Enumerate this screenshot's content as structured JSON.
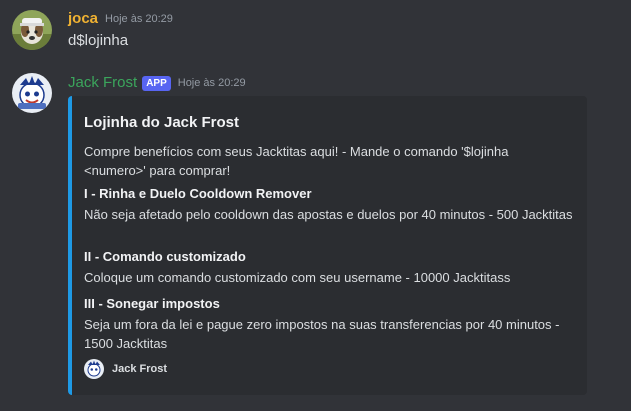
{
  "colors": {
    "background": "#313338",
    "joca_name": "#f0b232",
    "jack_name": "#3ba55c",
    "app_tag": "#5865f2",
    "embed_bar": "#1e9ae6",
    "embed_bg": "#2b2d31"
  },
  "messages": [
    {
      "author": "joca",
      "timestamp": "Hoje às 20:29",
      "content": "d$lojinha",
      "avatar_icon": "dog-avatar-icon"
    },
    {
      "author": "Jack Frost",
      "tag": "APP",
      "timestamp": "Hoje às 20:29",
      "avatar_icon": "jack-frost-avatar-icon",
      "embed": {
        "title": "Lojinha do Jack Frost",
        "description": "Compre benefícios com seus Jacktitas aqui! - Mande o comando '$lojinha <numero>' para comprar!",
        "fields": [
          {
            "name": "I - Rinha e Duelo Cooldown Remover",
            "value": "Não seja afetado pelo cooldown das apostas e duelos por 40 minutos - 500 Jacktitas"
          },
          {
            "name": "II - Comando customizado",
            "value": "Coloque um comando customizado com seu username - 10000 Jacktitass"
          },
          {
            "name": "III - Sonegar impostos",
            "value": "Seja um fora da lei e pague zero impostos na suas transferencias por 40 minutos - 1500 Jacktitas"
          }
        ],
        "footer": "Jack Frost"
      }
    }
  ]
}
